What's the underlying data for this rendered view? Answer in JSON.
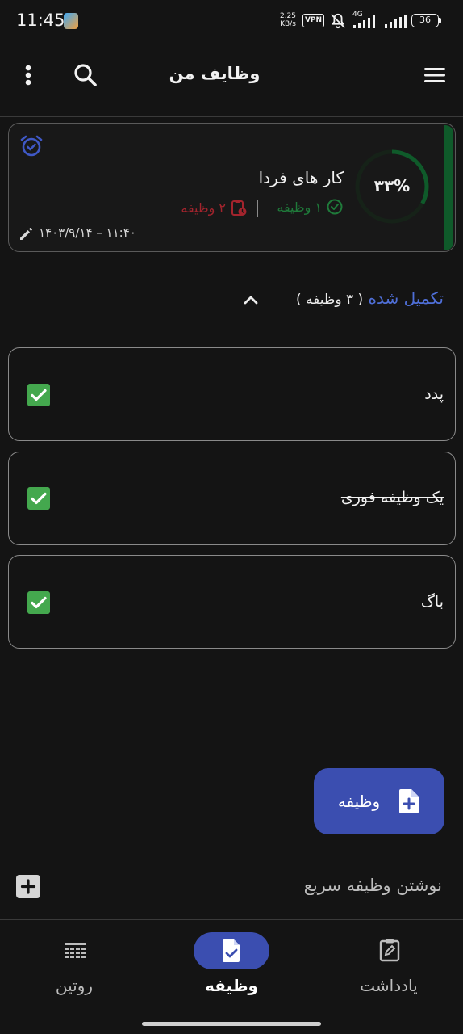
{
  "status_bar": {
    "time": "11:45",
    "speed_value": "2.25",
    "speed_unit": "KB/s",
    "vpn": "VPN",
    "network": "4G",
    "battery": "36"
  },
  "app_bar": {
    "title": "وظایف من"
  },
  "category": {
    "title": "کار های فردا",
    "progress_label": "۳۳%",
    "progress": 0.33,
    "completed_label": "۱ وظیفه",
    "pending_label": "۲ وظیفه",
    "datetime": "۱۴۰۳/۹/۱۴ – ۱۱:۴۰",
    "colors": {
      "accent": "#0f5a2a",
      "completed": "#1f7a3a",
      "pending": "#a3242d",
      "alarm": "#3f58c6"
    }
  },
  "completed_section": {
    "title": "تکمیل شده",
    "count_label": "( ۳ وظیفه )"
  },
  "tasks": [
    {
      "title": "پدد",
      "checked": true
    },
    {
      "title": "یک وظیفه فوری",
      "checked": true
    },
    {
      "title": "باگ",
      "checked": true
    }
  ],
  "fab": {
    "label": "وظیفه"
  },
  "quick_add": {
    "placeholder": "نوشتن وظیفه سریع"
  },
  "bottom_nav": {
    "items": [
      {
        "label": "یادداشت",
        "icon": "note-edit-icon",
        "active": false
      },
      {
        "label": "وظیفه",
        "icon": "task-doc-icon",
        "active": true
      },
      {
        "label": "روتین",
        "icon": "routine-grid-icon",
        "active": false
      }
    ]
  },
  "colors": {
    "background": "#141414",
    "primary": "#3b4eb0",
    "check_green": "#44a84e"
  }
}
